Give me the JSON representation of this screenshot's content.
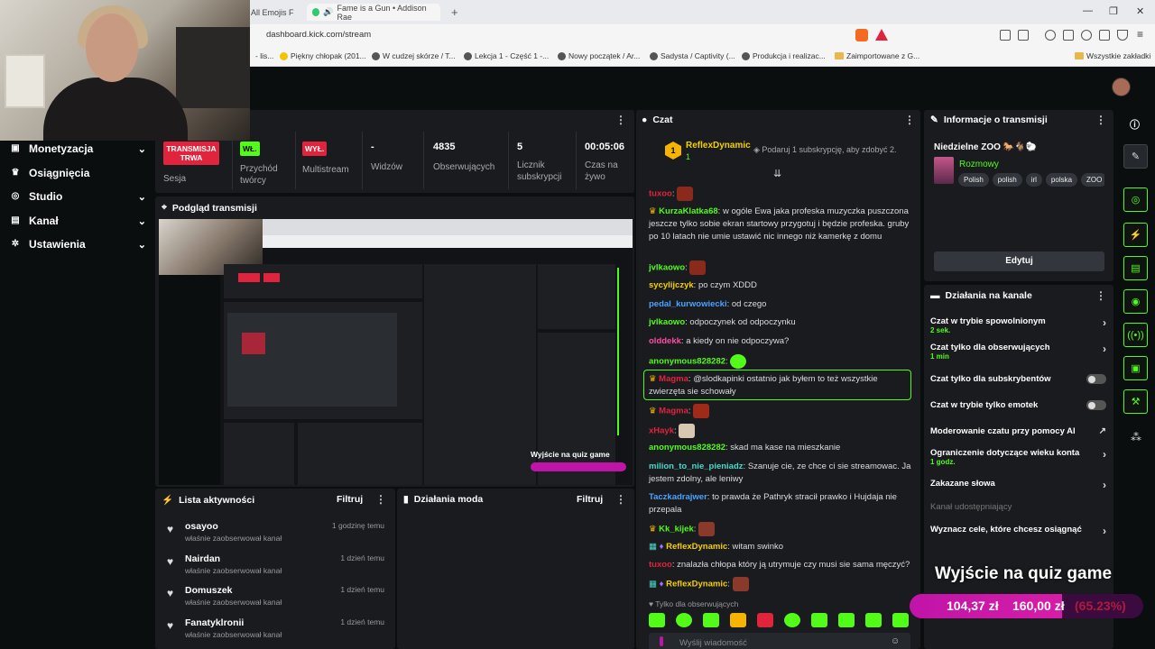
{
  "browser": {
    "tabs": [
      {
        "label": "All Emojis F"
      },
      {
        "label": "Fame is a Gun • Addison Rae"
      }
    ],
    "url": "dashboard.kick.com/stream",
    "bookmarks": [
      {
        "label": "- lis..."
      },
      {
        "label": "Piękny chłopak (201..."
      },
      {
        "label": "W cudzej skórze / T..."
      },
      {
        "label": "Lekcja 1 - Część 1 -..."
      },
      {
        "label": "Nowy początek / Ar..."
      },
      {
        "label": "Sadysta / Captivity (..."
      },
      {
        "label": "Produkcja i realizac..."
      },
      {
        "label": "Zaimportowane z G..."
      },
      {
        "label": "Wszystkie zakładki"
      }
    ]
  },
  "sidebar": {
    "items": [
      {
        "label": "Monetyzacja",
        "icon": "money-icon",
        "chevron": "⌄"
      },
      {
        "label": "Osiągnięcia",
        "icon": "trophy-icon"
      },
      {
        "label": "Studio",
        "icon": "studio-icon",
        "chevron": "⌄"
      },
      {
        "label": "Kanał",
        "icon": "channel-icon",
        "chevron": "⌄"
      },
      {
        "label": "Ustawienia",
        "icon": "gear-icon",
        "chevron": "⌄"
      }
    ]
  },
  "stats": {
    "session_badge": "TRANSMISJA TRWA",
    "session_label": "Sesja",
    "income_badge": "WŁ.",
    "income_label": "Przychód twórcy",
    "multistream_badge": "WYŁ.",
    "multistream_label": "Multistream",
    "viewers_value": "-",
    "viewers_label": "Widzów",
    "followers_value": "4835",
    "followers_label": "Obserwujących",
    "subs_value": "5",
    "subs_label": "Licznik subskrypcji",
    "time_value": "00:05:06",
    "time_label": "Czas na żywo"
  },
  "preview": {
    "title": "Podgląd transmisji"
  },
  "activity": {
    "title": "Lista aktywności",
    "filter": "Filtruj",
    "items": [
      {
        "name": "osayoo",
        "sub": "właśnie zaobserwował kanał",
        "time": "1 godzinę temu"
      },
      {
        "name": "Nairdan",
        "sub": "właśnie zaobserwował kanał",
        "time": "1 dzień temu"
      },
      {
        "name": "Domuszek",
        "sub": "właśnie zaobserwował kanał",
        "time": "1 dzień temu"
      },
      {
        "name": "Fanatyklronii",
        "sub": "właśnie zaobserwował kanał",
        "time": "1 dzień temu"
      }
    ]
  },
  "mod_actions": {
    "title": "Działania moda",
    "filter": "Filtruj"
  },
  "chat": {
    "title": "Czat",
    "pinned_user": "ReflexDynamic",
    "pinned_count": "1",
    "gift_text": "Podaruj 1 subskrypcję, aby zdobyć 2.",
    "messages": [
      {
        "user": "tuxoo",
        "color": "#e0243d",
        "text": ""
      },
      {
        "user": "KurzaKlatka68",
        "color": "#53fc18",
        "text": "w ogóle Ewa jaka profeska muzyczka puszczona jeszcze tylko sobie ekran startowy przygotuj i będzie profeska. gruby po 10 latach nie umie ustawić nic innego niż kamerkę z domu"
      },
      {
        "user": "jvlkaowo",
        "color": "#53fc18",
        "text": ""
      },
      {
        "user": "sycylijczyk",
        "color": "#f5d000",
        "text": "po czym XDDD"
      },
      {
        "user": "pedal_kurwowiecki",
        "color": "#4aa3ff",
        "text": "od czego"
      },
      {
        "user": "jvlkaowo",
        "color": "#53fc18",
        "text": "odpoczynek od odpoczynku"
      },
      {
        "user": "olddekk",
        "color": "#ff4da6",
        "text": "a kiedy on nie odpoczywa?"
      },
      {
        "user": "anonymous828282",
        "color": "#53fc18",
        "text": ""
      },
      {
        "user": "Magma",
        "color": "#e0243d",
        "text": "@slodkapinki ostatnio jak byłem to też wszystkie zwierzęta sie schowały"
      },
      {
        "user": "Magma",
        "color": "#e0243d",
        "text": ""
      },
      {
        "user": "xHayk",
        "color": "#e0243d",
        "text": ""
      },
      {
        "user": "anonymous828282",
        "color": "#53fc18",
        "text": "skad ma kase na mieszkanie"
      },
      {
        "user": "milion_to_nie_pieniadz",
        "color": "#4ad9c8",
        "text": "Szanuje cie, ze chce ci sie streamowac. Ja jestem zdolny, ale leniwy"
      },
      {
        "user": "Taczkadrajwer",
        "color": "#4aa3ff",
        "text": "to prawda że Pathryk stracił prawko i Hujdaja nie przepala"
      },
      {
        "user": "Kk_kijek",
        "color": "#53fc18",
        "text": ""
      },
      {
        "user": "ReflexDynamic",
        "color": "#f5d000",
        "text": "witam swinko"
      },
      {
        "user": "tuxoo",
        "color": "#e0243d",
        "text": "znalazła chłopa który ją utrymuje czy musi sie sama męczyć?"
      },
      {
        "user": "ReflexDynamic",
        "color": "#f5d000",
        "text": ""
      }
    ],
    "followers_only": "Tylko dla obserwujących",
    "input_placeholder": "Wyślij wiadomość"
  },
  "stream_info": {
    "title": "Informacje o transmisji",
    "stream_title": "Niedzielne ZOO",
    "category": "Rozmowy",
    "tags": [
      "Polish",
      "polish",
      "irl",
      "polska",
      "ZOO"
    ],
    "edit_button": "Edytuj"
  },
  "channel_actions": {
    "title": "Działania na kanale",
    "items": [
      {
        "label": "Czat w trybie spowolnionym",
        "value": "2 sek."
      },
      {
        "label": "Czat tylko dla obserwujących",
        "value": "1 min"
      },
      {
        "label": "Czat tylko dla subskrybentów",
        "value": ""
      },
      {
        "label": "Czat w trybie tylko emotek",
        "value": ""
      },
      {
        "label": "Moderowanie czatu przy pomocy AI",
        "value": ""
      },
      {
        "label": "Ograniczenie dotyczące wieku konta",
        "value": "1 godz."
      },
      {
        "label": "Zakazane słowa",
        "value": ""
      },
      {
        "label": "Kanał udostępniający",
        "value": ""
      },
      {
        "label": "Wyznacz cele, które chcesz osiągnąć",
        "value": ""
      }
    ]
  },
  "goal": {
    "title": "Wyjście na quiz game",
    "current": "104,37 zł",
    "target": "160,00 zł",
    "percent_text": "(65.23%)",
    "progress": 0.6523
  },
  "colors": {
    "accent": "#53fc18",
    "live": "#e0243d",
    "goal": "#c014a8"
  }
}
